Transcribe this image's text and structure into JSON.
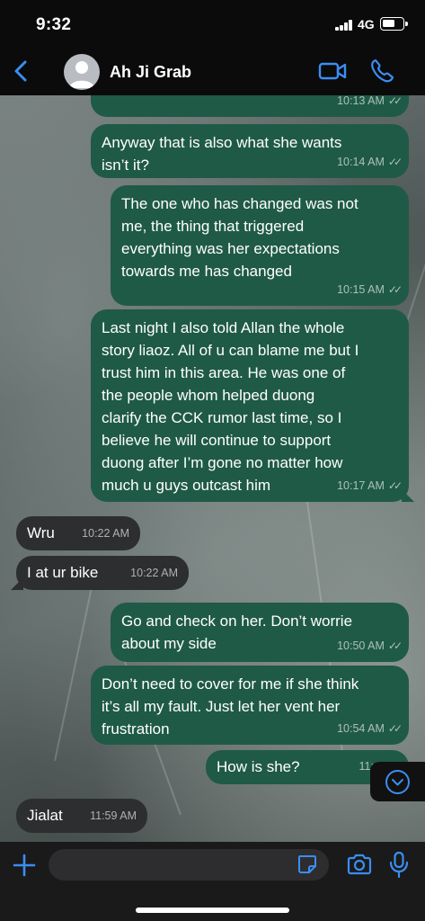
{
  "status_bar": {
    "time": "9:32",
    "network": "4G",
    "battery_level": 0.65
  },
  "header": {
    "contact_name": "Ah Ji Grab"
  },
  "messages": [
    {
      "direction": "outgoing",
      "text": "",
      "time": "10:13 AM",
      "status": "read"
    },
    {
      "direction": "outgoing",
      "text": "Anyway that is also what she wants\nisn’t it?",
      "time": "10:14 AM",
      "status": "read"
    },
    {
      "direction": "outgoing",
      "text": "The one who has changed was not\nme, the thing that triggered\neverything was her expectations\ntowards me has changed",
      "time": "10:15 AM",
      "status": "read"
    },
    {
      "direction": "outgoing",
      "text": "Last night I also told Allan the whole\nstory liaoz. All of u can blame me but I\ntrust him in this area. He was one of\nthe people whom helped duong\nclarify the CCK rumor last time, so I\nbelieve he will continue to support\nduong after I’m gone no matter how\nmuch u guys outcast him",
      "time": "10:17 AM",
      "status": "read"
    },
    {
      "direction": "incoming",
      "text": "Wru",
      "time": "10:22 AM"
    },
    {
      "direction": "incoming",
      "text": "I at ur bike",
      "time": "10:22 AM"
    },
    {
      "direction": "outgoing",
      "text": "Go and check on her. Don’t worrie\nabout my side",
      "time": "10:50 AM",
      "status": "read"
    },
    {
      "direction": "outgoing",
      "text": "Don’t need to cover for me if she think\nit’s all my fault. Just let her vent her\nfrustration",
      "time": "10:54 AM",
      "status": "read"
    },
    {
      "direction": "outgoing",
      "text": "How is she?",
      "time": "11:43 A",
      "status": "read"
    },
    {
      "direction": "incoming",
      "text": "Jialat",
      "time": "11:59 AM"
    }
  ],
  "composer": {
    "placeholder": ""
  },
  "colors": {
    "accent": "#3b8ef3",
    "outgoing_bubble": "#1f5a46",
    "incoming_bubble": "#2c2e2f"
  }
}
